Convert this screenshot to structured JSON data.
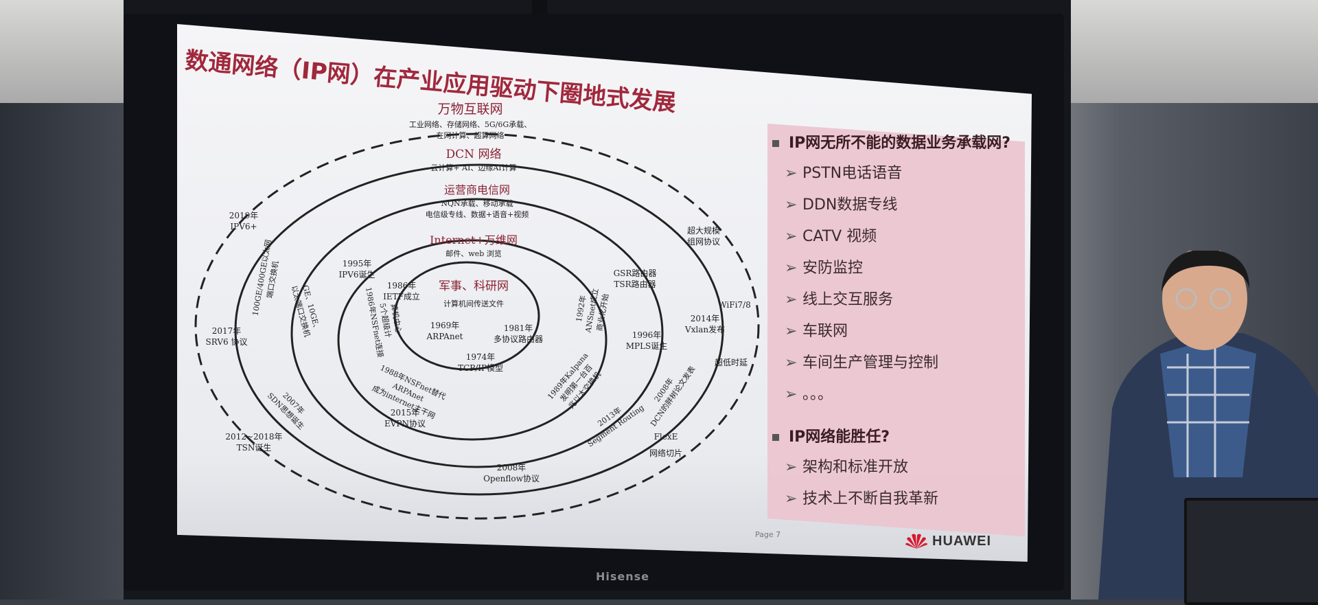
{
  "slide": {
    "title": "数通网络（IP网）在产业应用驱动下圈地式发展",
    "page": "Page 7",
    "logo_text": "HUAWEI"
  },
  "tv_brand": "Hisense",
  "rings": {
    "r1": {
      "title": "万物互联网",
      "line1": "工业网络、存储网络、5G/6G承载、",
      "line2": "在网计算、超算网络"
    },
    "r2": {
      "title": "DCN 网络",
      "line1": "云计算+ AI、边缘AI计算"
    },
    "r3": {
      "title": "运营商电信网",
      "line1": "NQN承载、移动承载",
      "line2": "电信级专线、数据+语音+视频"
    },
    "r4": {
      "title": "Internet+万维网",
      "line1": "邮件、web 浏览"
    },
    "r5": {
      "title": "军事、科研网",
      "line1": "计算机间传送文件"
    }
  },
  "events": {
    "e1969a": "1969年",
    "e1969b": "ARPAnet",
    "e1981a": "1981年",
    "e1981b": "多协议路由器",
    "e1974a": "1974年",
    "e1974b": "TCP/IP模型",
    "e1986a": "1986年",
    "e1986b": "IETF成立",
    "e1986c": "1986年NSFnet连接",
    "e1986d": "5个超级计",
    "e1986e": "算机中心",
    "e1988a": "1988年NSFnet替代",
    "e1988b": "ARPAnet",
    "e1988c": "成为internet主干网",
    "e1989a": "1989年Kalpana",
    "e1989b": "发明第一台百",
    "e1989c": "兆以太交换机",
    "e1992a": "1992年",
    "e1992b": "ANSnet成立",
    "e1992c": "商业化开始",
    "e_gsr1": "GSR路由器",
    "e_gsr2": "TSR路由器",
    "e1996a": "1996年",
    "e1996b": "MPLS诞生",
    "e1995a": "1995年",
    "e1995b": "IPV6诞生",
    "e_ge1": "GE、10GE、",
    "e_ge2": "以太端口交换机",
    "e_100ge1": "100GE/400GE以太网",
    "e_100ge2": "端口交换机",
    "e2014a": "2014年",
    "e2014b": "Vxlan发布",
    "e2013a": "2013年",
    "e2013b": "Segment Routing",
    "e2008v1": "2008年",
    "e2008v2": "DCN的胖树论文发表",
    "e2015a": "2015年",
    "e2015b": "EVPN协议",
    "e2007a": "2007年",
    "e2007b": "SDN思想诞生",
    "e2008oa": "2008年",
    "e2008ob": "Openflow协议",
    "e2019a": "2019年",
    "e2019b": "IPV6+",
    "e2017a": "2017年",
    "e2017b": "SRV6 协议",
    "e2012a": "2012~2018年",
    "e2012b": "TSN诞生",
    "e_big1": "超大规模",
    "e_big2": "组网协议",
    "e_wifi": "WiFi7/8",
    "e_low": "超低时延",
    "e_flex1": "FlexE",
    "e_flex2": "网络切片"
  },
  "panel": {
    "q1": "IP网无所不能的数据业务承载网?",
    "items1": [
      "PSTN电话语音",
      "DDN数据专线",
      "CATV 视频",
      "安防监控",
      "线上交互服务",
      "车联网",
      "车间生产管理与控制",
      "。。。"
    ],
    "q2": "IP网络能胜任?",
    "items2": [
      "架构和标准开放",
      "技术上不断自我革新"
    ]
  }
}
